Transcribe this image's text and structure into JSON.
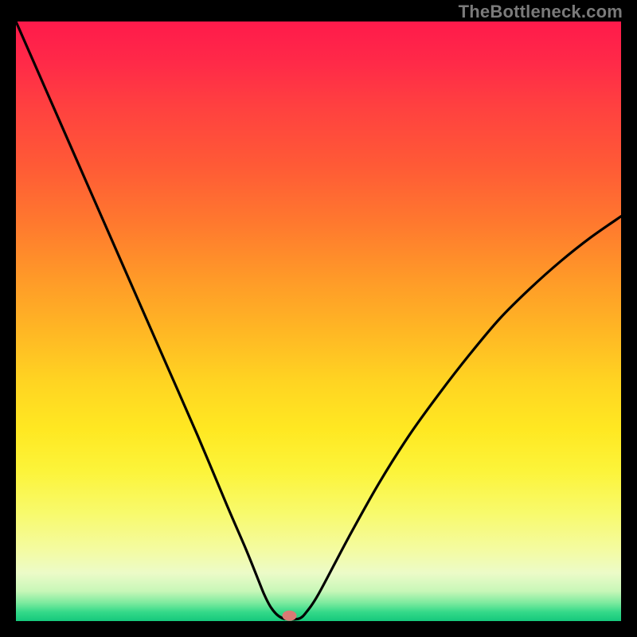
{
  "watermark": "TheBottleneck.com",
  "chart_data": {
    "type": "line",
    "title": "",
    "xlabel": "",
    "ylabel": "",
    "xlim": [
      0,
      100
    ],
    "ylim": [
      0,
      100
    ],
    "grid": false,
    "legend": false,
    "x": [
      0,
      5,
      10,
      15,
      20,
      25,
      30,
      35,
      38,
      40,
      41,
      42,
      43,
      44,
      45,
      46,
      47,
      48,
      50,
      55,
      60,
      65,
      70,
      75,
      80,
      85,
      90,
      95,
      100
    ],
    "values": [
      100,
      88.5,
      77,
      65.5,
      54,
      42.5,
      31,
      19,
      12,
      7,
      4.5,
      2.5,
      1.2,
      0.5,
      0.3,
      0.3,
      0.5,
      1.5,
      4.5,
      14,
      23,
      31,
      38,
      44.5,
      50.5,
      55.5,
      60,
      64,
      67.5
    ],
    "marker": {
      "x_pct": 45.2,
      "y_pct": 99.1,
      "color": "#d87a74"
    },
    "gradient_stops": [
      {
        "pos": 0,
        "color": "#ff1a4b"
      },
      {
        "pos": 50,
        "color": "#ffc822"
      },
      {
        "pos": 90,
        "color": "#f4fba0"
      },
      {
        "pos": 100,
        "color": "#16c97c"
      }
    ]
  }
}
